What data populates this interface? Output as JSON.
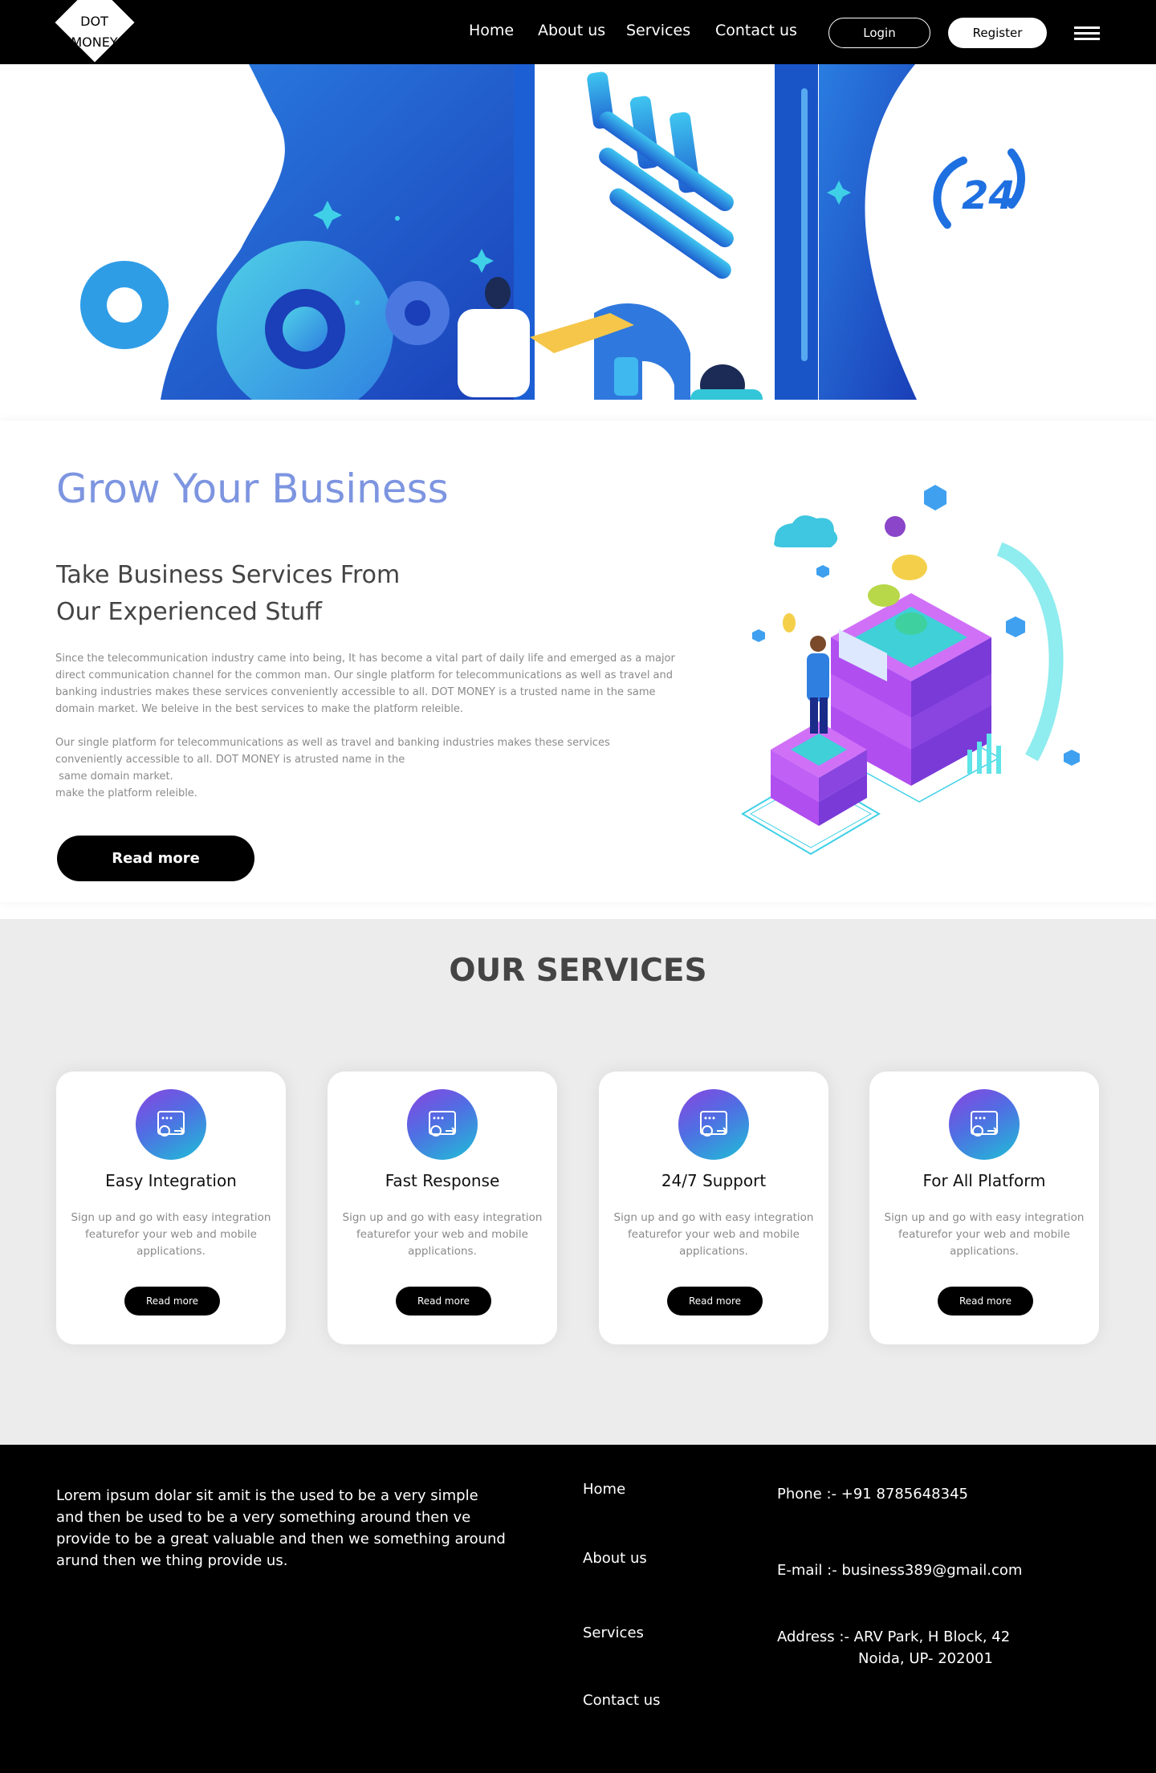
{
  "nav": {
    "logo_line1": "DOT",
    "logo_line2": "MONEY",
    "links": [
      "Home",
      "About us",
      "Services",
      "Contact us"
    ],
    "login_label": "Login",
    "register_label": "Register"
  },
  "hero": {
    "badge_text": "24"
  },
  "grow": {
    "title": "Grow Your Business",
    "subtitle_line1": "Take Business Services From",
    "subtitle_line2": "Our Experienced Stuff",
    "paragraph1": "Since the telecommunication industry came into being, It has become a vital part of daily life and emerged as a major direct communication channel for the common man. Our single platform for telecommunications as well as travel and banking industries makes these services conveniently accessible to all. DOT MONEY is a trusted name in the same domain market. We beleive in the best services to make the platform releible.",
    "paragraph2_line1": "Our single platform for telecommunications as well as travel and banking industries makes these services",
    "paragraph2_line2": "conveniently accessible to all. DOT MONEY is atrusted name in the",
    "paragraph2_line3": " same domain market.",
    "paragraph2_line4": "make the platform releible.",
    "read_more_label": "Read more"
  },
  "services": {
    "title": "OUR SERVICES",
    "cards": [
      {
        "title": "Easy Integration",
        "description": "Sign up and go with easy integration featurefor your web and mobile applications.",
        "button": "Read more",
        "icon": "integration-icon"
      },
      {
        "title": "Fast Response",
        "description": "Sign up and go with easy integration featurefor your web and mobile applications.",
        "button": "Read more",
        "icon": "integration-icon"
      },
      {
        "title": "24/7 Support",
        "description": "Sign up and go with easy integration featurefor your web and mobile applications.",
        "button": "Read more",
        "icon": "integration-icon"
      },
      {
        "title": "For All Platform",
        "description": "Sign up and go with easy integration featurefor your web and mobile applications.",
        "button": "Read more",
        "icon": "integration-icon"
      }
    ]
  },
  "footer": {
    "about": "Lorem ipsum dolar sit amit is the used to be a very  simple and then be used to be a very something around then ve provide to be a great valuable and then we something around arund then we thing provide us.",
    "links": [
      "Home",
      "About us",
      "Services",
      "Contact us"
    ],
    "phone": "Phone :- +91 8785648345",
    "email": "E-mail :- business389@gmail.com",
    "address_line1": "Address :- ARV Park, H Block, 42",
    "address_line2": "Noida, UP- 202001"
  },
  "colors": {
    "accent_title": "#7d95e0",
    "hero_blue": "#1e5fd0",
    "nav_bg": "#000000",
    "services_bg": "#ececec"
  }
}
